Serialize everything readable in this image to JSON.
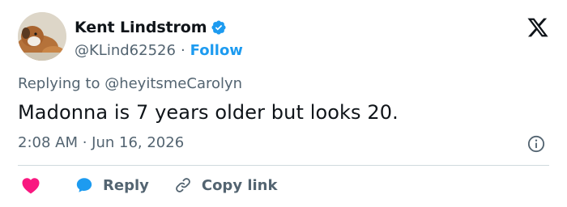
{
  "author": {
    "display_name": "Kent Lindstrom",
    "handle": "@KLind62526",
    "separator": "·",
    "follow_label": "Follow"
  },
  "tweet": {
    "reply_prefix": "Replying to ",
    "reply_mention": "@heyitsmeCarolyn",
    "text": "Madonna is 7 years older but looks 20.",
    "timestamp": "2:08 AM · Jun 16, 2026"
  },
  "actions": {
    "reply_label": "Reply",
    "copy_link_label": "Copy link"
  },
  "icons": {
    "verified": "verified-badge-icon",
    "brand": "x-logo-icon",
    "info": "info-icon",
    "like": "heart-icon",
    "reply": "speech-bubble-icon",
    "copy_link": "link-icon"
  },
  "colors": {
    "accent": "#1d9bf0",
    "like": "#f91880",
    "muted_text": "#536471",
    "primary_text": "#0f1419",
    "divider": "#cfd9de"
  }
}
